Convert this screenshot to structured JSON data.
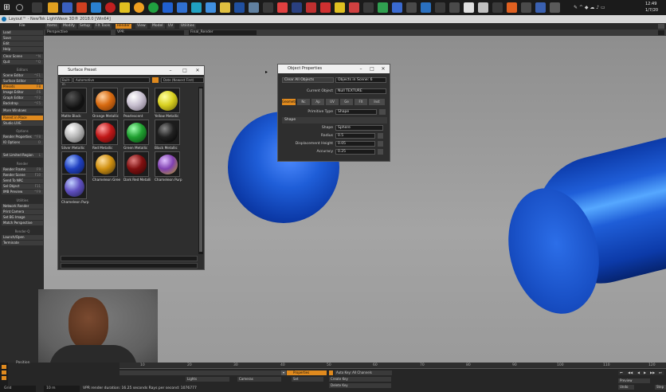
{
  "taskbar": {
    "clock_time": "12:49",
    "clock_date": "1/7/20"
  },
  "window": {
    "title": "Layout™ - NewTek LightWave 3D® 2018.0 [Win64]"
  },
  "menu": {
    "file": "File",
    "tabs": [
      "Items",
      "Modify",
      "Setup",
      "FX Tools",
      "Render",
      "View",
      "Model",
      "UV",
      "Utilities"
    ],
    "active_tab": "Render"
  },
  "viewbar": {
    "view_mode": "Perspective",
    "render_mode": "VPR",
    "camera": "Final_Render"
  },
  "sidebar": {
    "items": [
      {
        "label": "Load",
        "key": ""
      },
      {
        "label": "Save",
        "key": ""
      },
      {
        "label": "Edit",
        "key": ""
      },
      {
        "label": "Help",
        "key": ""
      },
      {
        "label": "Clear Scene",
        "key": "^N"
      },
      {
        "label": "Quit",
        "key": "^Q"
      }
    ],
    "editors_header": "Editors",
    "editors": [
      {
        "label": "Scene Editor",
        "key": "^F1"
      },
      {
        "label": "Surface Editor",
        "key": "F5"
      },
      {
        "label": "Presets",
        "key": "F8"
      },
      {
        "label": "Image Editor",
        "key": "F6"
      },
      {
        "label": "Graph Editor",
        "key": "^F2"
      },
      {
        "label": "Backdrop",
        "key": "^F5"
      },
      {
        "label": "More Windows",
        "key": ""
      },
      {
        "label": "Parent in Place",
        "key": ""
      },
      {
        "label": "Studio LIVE",
        "key": ""
      }
    ],
    "options_header": "Options",
    "options": [
      {
        "label": "Render Properties",
        "key": "^F8"
      },
      {
        "label": "IO Options",
        "key": "O"
      },
      {
        "label": "Set Limited Region",
        "key": "L"
      }
    ],
    "render_header": "Render",
    "render": [
      {
        "label": "Render Frame",
        "key": "F9"
      },
      {
        "label": "Render Scene",
        "key": "F10"
      },
      {
        "label": "Send To NRC",
        "key": ""
      },
      {
        "label": "Sel Object",
        "key": "F11"
      },
      {
        "label": "IMB Preview",
        "key": "^F9"
      }
    ],
    "utilities_header": "Utilities",
    "utilities": [
      {
        "label": "Network Render"
      },
      {
        "label": "Print Camera"
      },
      {
        "label": "Set BG Image"
      },
      {
        "label": "Match Perspective"
      }
    ],
    "renderq_header": "Render-Q",
    "renderq": [
      {
        "label": "Launch/Open"
      },
      {
        "label": "Terminate"
      }
    ]
  },
  "surface_preset": {
    "title": "Surface Preset",
    "library": "Built-in",
    "category": "Automotive",
    "sort": "Date (Newest First)",
    "swatches": [
      {
        "name": "Matte Black",
        "color": "#111111"
      },
      {
        "name": "Orange Metallic",
        "color": "#d86a10"
      },
      {
        "name": "Pearlescent",
        "color": "#c8c0d0"
      },
      {
        "name": "Yellow Metallic",
        "color": "#d8d020"
      },
      {
        "name": "Silver Metallic",
        "color": "#b8b8b8"
      },
      {
        "name": "Red Metallic",
        "color": "#c01818"
      },
      {
        "name": "Green Metallic",
        "color": "#20a030"
      },
      {
        "name": "Black Metallic",
        "color": "#222222"
      },
      {
        "name": "Blue Metallic",
        "color": "#2040c0"
      },
      {
        "name": "Chameleon Gree",
        "color": "#d09010"
      },
      {
        "name": "Dark Red Metalli",
        "color": "#801010"
      },
      {
        "name": "Chameleon Purp",
        "color": "#8040b0"
      },
      {
        "name": "Chameleon Purp",
        "color": "#6050c0"
      }
    ]
  },
  "object_properties": {
    "title": "Object Properties",
    "clear_all": "Clear All Objects",
    "objects_in_scene_label": "Objects in Scene:",
    "objects_in_scene": "6",
    "current_object_label": "Current Object",
    "current_object": "Null TEXTURE",
    "tabs": [
      "Geometry",
      "Nc",
      "Ap",
      "UV",
      "Ge",
      "FX",
      "Inst"
    ],
    "primitive_type_label": "Primitive Type",
    "primitive_type": "Shape",
    "section": "Shape",
    "shape_label": "Shape",
    "shape": "Sphere",
    "radius_label": "Radius",
    "radius": "0.5",
    "displacement_label": "Displacement Height",
    "displacement": "0.05",
    "accuracy_label": "Accuracy",
    "accuracy": "0.25"
  },
  "timeline": {
    "position_label": "Position",
    "ticks": [
      "10",
      "20",
      "30",
      "40",
      "50",
      "60",
      "70",
      "80",
      "90",
      "100",
      "110",
      "120"
    ],
    "lights": "Lights",
    "cameras": "Cameras",
    "properties": "Properties",
    "auto_key": "Auto Key: All Channels",
    "create_key": "Create Key",
    "delete_key": "Delete Key",
    "set": "Set",
    "grid_label": "Grid",
    "grid_value": "10 m",
    "status": "VPR render duration: 16.25 seconds  Rays per second: 1076777",
    "preview": "Preview",
    "undo": "Undo",
    "step": "Step"
  },
  "colors": {
    "accent": "#e08a1e",
    "object_blue": "#1f5ed8"
  }
}
